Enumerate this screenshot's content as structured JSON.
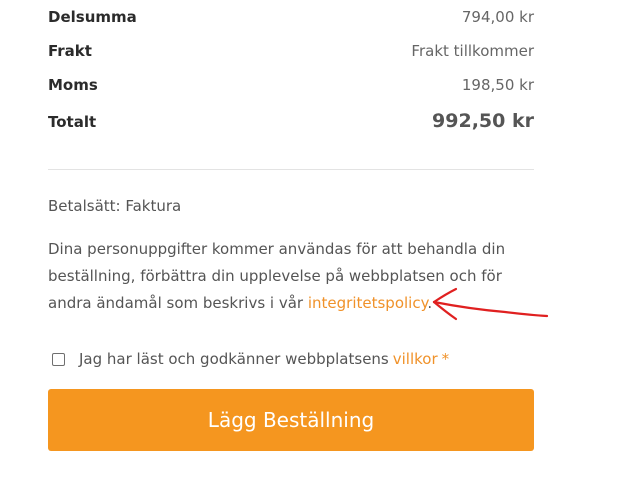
{
  "summary": {
    "subtotal_label": "Delsumma",
    "subtotal_value": "794,00 kr",
    "shipping_label": "Frakt",
    "shipping_value": "Frakt tillkommer",
    "tax_label": "Moms",
    "tax_value": "198,50 kr",
    "total_label": "Totalt",
    "total_value": "992,50 kr"
  },
  "payment": {
    "text": "Betalsätt: Faktura"
  },
  "privacy": {
    "text": "Dina personuppgifter kommer användas för att behandla din beställning, förbättra din upplevelse på webbplatsen och för andra ändamål som beskrivs i vår ",
    "link_text": "integritetspolicy",
    "suffix": "."
  },
  "terms": {
    "checked": false,
    "text": "Jag har läst och godkänner webbplatsens ",
    "link_text": "villkor",
    "required_mark": "*"
  },
  "order_button": {
    "label": "Lägg Beställning"
  },
  "colors": {
    "accent": "#f5961f",
    "link": "#f0922a",
    "annotation": "#e02020"
  },
  "annotation": {
    "icon": "red-hand-drawn-arrow-icon"
  }
}
